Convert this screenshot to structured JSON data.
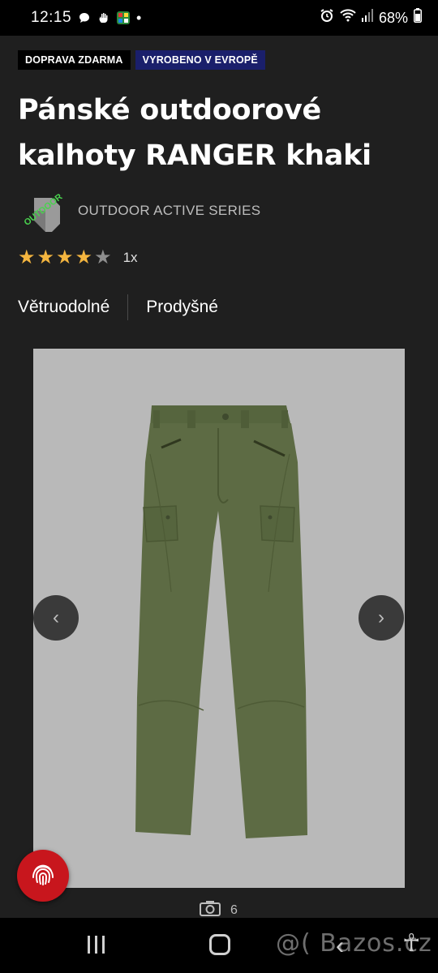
{
  "status_bar": {
    "time": "12:15",
    "battery": "68%",
    "icons": [
      "chat-bubble-icon",
      "hand-icon",
      "grid-app-icon",
      "dot-icon",
      "alarm-icon",
      "wifi-icon",
      "signal-icon",
      "battery-icon"
    ]
  },
  "badges": {
    "free_shipping": "DOPRAVA ZDARMA",
    "made_in_europe": "VYROBENO V EVROPĚ"
  },
  "product": {
    "title": "Pánské outdoorové kalhoty RANGER khaki",
    "brand": "OUTDOOR ACTIVE SERIES",
    "brand_logo_text": "OUTDOOR",
    "rating": {
      "value": 4,
      "max": 5,
      "count": "1x"
    },
    "features": [
      "Větruodolné",
      "Prodyšné"
    ],
    "photo_count": "6"
  },
  "colors": {
    "badge_europe": "#1a1f6b",
    "star": "#f4b53f",
    "fingerprint_button": "#c8161d",
    "pants": "#5d6b44"
  },
  "watermark": "@( Bazos.cz"
}
